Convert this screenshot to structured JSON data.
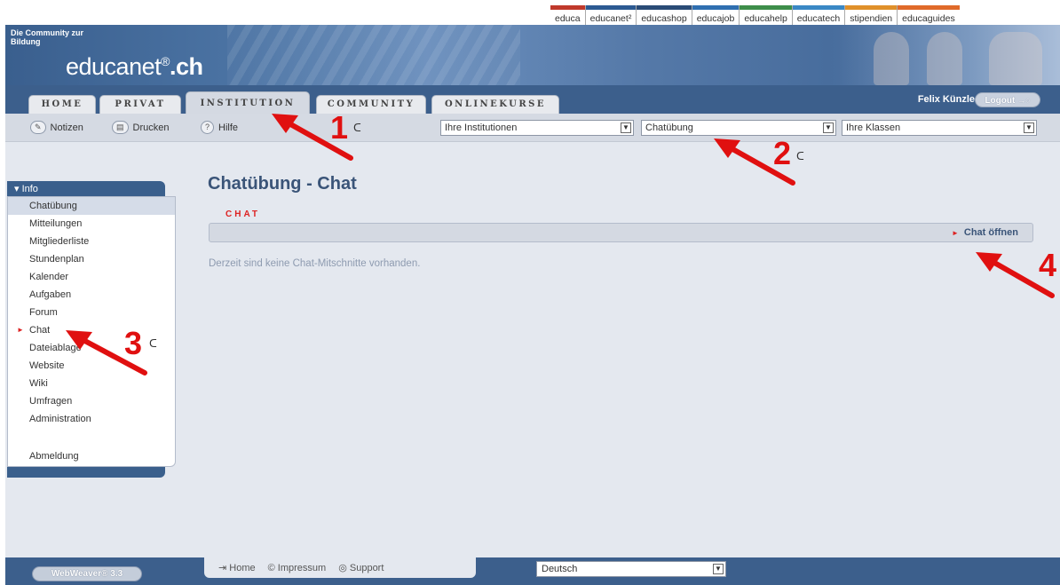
{
  "portal_links": [
    {
      "label": "educa",
      "color": "#c0392b"
    },
    {
      "label": "educanet²",
      "color": "#2c5a92"
    },
    {
      "label": "educashop",
      "color": "#2a4b76"
    },
    {
      "label": "educajob",
      "color": "#2f6fb0"
    },
    {
      "label": "educahelp",
      "color": "#3e8e4a"
    },
    {
      "label": "educatech",
      "color": "#3a88c5"
    },
    {
      "label": "stipendien",
      "color": "#e0902a"
    },
    {
      "label": "educaguides",
      "color": "#e06a2a"
    }
  ],
  "header": {
    "tagline": "Die Community zur Bildung",
    "logo_main": "educanet",
    "logo_reg": "®",
    "logo_suffix": ".ch"
  },
  "tabs": [
    "HOME",
    "PRIVAT",
    "INSTITUTION",
    "COMMUNITY",
    "ONLINEKURSE"
  ],
  "active_tab": "INSTITUTION",
  "user": {
    "name": "Felix Künzle",
    "logout_label": "Logout",
    "logout_icon": "→○"
  },
  "toolbar": {
    "notes_label": "Notizen",
    "notes_icon": "✎",
    "print_label": "Drucken",
    "print_icon": "▤",
    "help_label": "Hilfe",
    "help_icon": "?",
    "institutions_select": "Ihre Institutionen",
    "course_select": "Chatübung",
    "classes_select": "Ihre Klassen"
  },
  "sidebar": {
    "header": "▾ Info",
    "items": [
      "Chatübung",
      "Mitteilungen",
      "Mitgliederliste",
      "Stundenplan",
      "Kalender",
      "Aufgaben",
      "Forum",
      "Chat",
      "Dateiablage",
      "Website",
      "Wiki",
      "Umfragen",
      "Administration"
    ],
    "logout_item": "Abmeldung",
    "selected": "Chatübung",
    "current": "Chat"
  },
  "main": {
    "title": "Chatübung - Chat",
    "section_label": "CHAT",
    "open_chat_label": "Chat öffnen",
    "empty_message": "Derzeit sind keine Chat-Mitschnitte vorhanden."
  },
  "annotations": [
    "1",
    "2",
    "3",
    "4"
  ],
  "footer": {
    "brand_label": "WebWeaver® 3.3",
    "links": [
      {
        "label": "Home",
        "icon": "⇥"
      },
      {
        "label": "Impressum",
        "icon": "©"
      },
      {
        "label": "Support",
        "icon": "◎"
      }
    ],
    "language": "Deutsch"
  },
  "colors": {
    "header_blue": "#3c5f8c",
    "accent_red": "#d22222",
    "title_blue": "#3a5478",
    "background": "#e4e8ef"
  }
}
